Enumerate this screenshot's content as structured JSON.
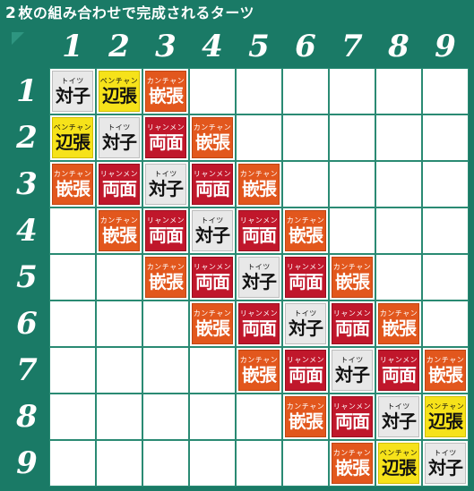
{
  "title": {
    "prefix": "2",
    "text": "枚の組み合わせで完成されるターツ"
  },
  "column_headers": [
    "1",
    "2",
    "3",
    "4",
    "5",
    "6",
    "7",
    "8",
    "9"
  ],
  "row_headers": [
    "1",
    "2",
    "3",
    "4",
    "5",
    "6",
    "7",
    "8",
    "9"
  ],
  "taatsu_types": {
    "toitsu": {
      "ruby": "トイツ",
      "word": "対子"
    },
    "penchan": {
      "ruby": "ペンチャン",
      "word": "辺張"
    },
    "kanchan": {
      "ruby": "カンチャン",
      "word": "嵌張"
    },
    "ryanmen": {
      "ruby": "リャンメン",
      "word": "両面"
    }
  },
  "matrix": [
    [
      "toitsu",
      "penchan",
      "kanchan",
      "",
      "",
      "",
      "",
      "",
      ""
    ],
    [
      "penchan",
      "toitsu",
      "ryanmen",
      "kanchan",
      "",
      "",
      "",
      "",
      ""
    ],
    [
      "kanchan",
      "ryanmen",
      "toitsu",
      "ryanmen",
      "kanchan",
      "",
      "",
      "",
      ""
    ],
    [
      "",
      "kanchan",
      "ryanmen",
      "toitsu",
      "ryanmen",
      "kanchan",
      "",
      "",
      ""
    ],
    [
      "",
      "",
      "kanchan",
      "ryanmen",
      "toitsu",
      "ryanmen",
      "kanchan",
      "",
      ""
    ],
    [
      "",
      "",
      "",
      "kanchan",
      "ryanmen",
      "toitsu",
      "ryanmen",
      "kanchan",
      ""
    ],
    [
      "",
      "",
      "",
      "",
      "kanchan",
      "ryanmen",
      "toitsu",
      "ryanmen",
      "kanchan"
    ],
    [
      "",
      "",
      "",
      "",
      "",
      "kanchan",
      "ryanmen",
      "toitsu",
      "penchan"
    ],
    [
      "",
      "",
      "",
      "",
      "",
      "",
      "kanchan",
      "penchan",
      "toitsu"
    ]
  ],
  "colors": {
    "frame": "#1a7a66",
    "toitsu": "#e8e8e8",
    "penchan": "#f6e21a",
    "kanchan": "#e2571d",
    "ryanmen": "#c0172b",
    "empty": "#ffffff"
  }
}
